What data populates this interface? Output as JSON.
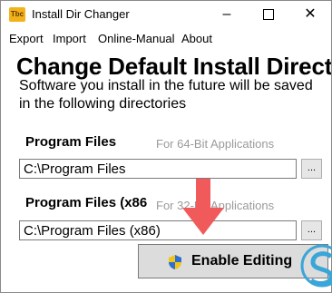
{
  "window": {
    "title": "Install Dir Changer",
    "icon_text": "Tbc",
    "controls": {
      "minimize": "–",
      "maximize": "",
      "close": "✕"
    }
  },
  "menu": {
    "items": [
      "Export",
      "Import",
      "Online-Manual",
      "About"
    ]
  },
  "main": {
    "heading": "Change Default Install Directo",
    "description": "Software you install in the future will be saved in the following directories",
    "program_files": {
      "label": "Program Files",
      "hint": "For 64-Bit Applications",
      "value": "C:\\Program Files",
      "browse_label": "..."
    },
    "program_files_x86": {
      "label": "Program Files (x86",
      "hint": "For 32-Bit Applications",
      "value": "C:\\Program Files (x86)",
      "browse_label": "..."
    },
    "enable_button": {
      "label": "Enable Editing"
    }
  },
  "colors": {
    "arrow": "#f05a5a",
    "app_icon": "#f3b21b",
    "watermark": "#3aa6d8"
  },
  "icons": [
    "app-icon",
    "shield-icon",
    "arrow-down-icon",
    "watermark-logo-icon"
  ]
}
